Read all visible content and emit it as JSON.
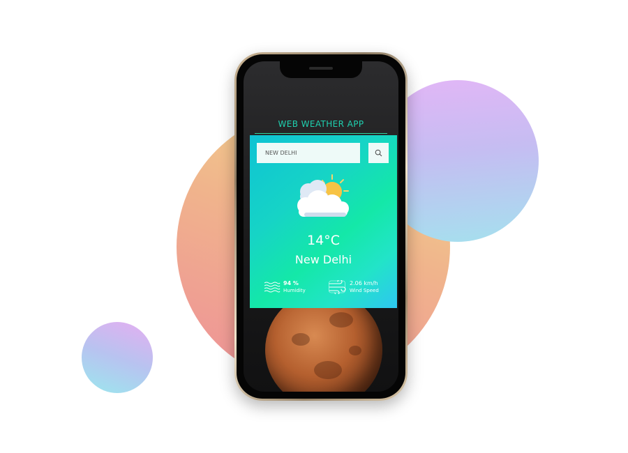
{
  "app": {
    "title": "WEB WEATHER APP"
  },
  "search": {
    "value": "NEW DELHI",
    "button_icon": "search-icon"
  },
  "weather": {
    "icon": "sun-behind-clouds-icon",
    "temperature": "14°C",
    "city": "New Delhi"
  },
  "humidity": {
    "icon": "water-waves-icon",
    "value": "94 %",
    "label": "Humidity"
  },
  "wind": {
    "icon": "wind-icon",
    "value": "2.06 km/h",
    "label": "Wind Speed"
  },
  "colors": {
    "accent": "#1fd1b0",
    "card_gradient": [
      "#0fc3d4",
      "#14e8a8",
      "#2ec6f0"
    ]
  }
}
